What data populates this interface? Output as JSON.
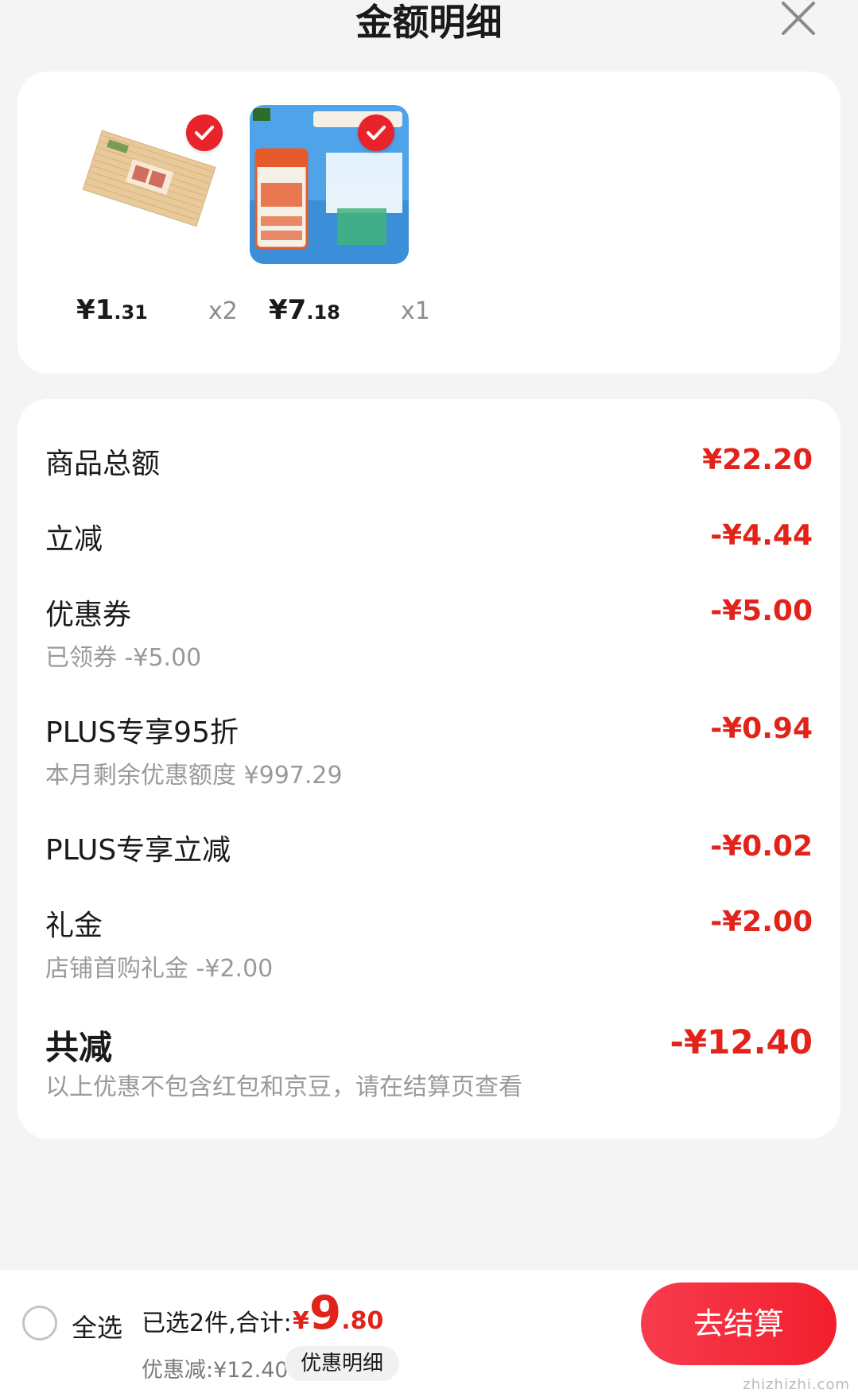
{
  "header": {
    "title": "金额明细"
  },
  "products": [
    {
      "price_int": "¥1",
      "price_dec": ".31",
      "qty": "x2"
    },
    {
      "price_int": "¥7",
      "price_dec": ".18",
      "qty": "x1"
    }
  ],
  "details": {
    "subtotal": {
      "label": "商品总额",
      "amount": "¥22.20"
    },
    "instant": {
      "label": "立减",
      "amount": "-¥4.44"
    },
    "coupon": {
      "label": "优惠券",
      "amount": "-¥5.00",
      "sub": "已领券 -¥5.00"
    },
    "plus95": {
      "label": "PLUS专享95折",
      "amount": "-¥0.94",
      "sub": "本月剩余优惠额度 ¥997.29"
    },
    "plus_instant": {
      "label": "PLUS专享立减",
      "amount": "-¥0.02"
    },
    "gift": {
      "label": "礼金",
      "amount": "-¥2.00",
      "sub": "店铺首购礼金 -¥2.00"
    },
    "total": {
      "label": "共减",
      "amount": "-¥12.40",
      "sub": "以上优惠不包含红包和京豆，请在结算页查看"
    }
  },
  "bottom": {
    "select_all": "全选",
    "selected_text": "已选2件,合计:",
    "sum_currency": "¥",
    "sum_int": "9",
    "sum_dec": ".80",
    "discount": "优惠减:¥12.40",
    "detail_button": "优惠明细",
    "checkout_button": "去结算",
    "watermark": "zhizhizhi.com"
  },
  "colors": {
    "accent": "#e2231a",
    "checkout": "#f11f2d"
  },
  "icons": [
    "close-icon",
    "check-icon",
    "radio-icon"
  ]
}
